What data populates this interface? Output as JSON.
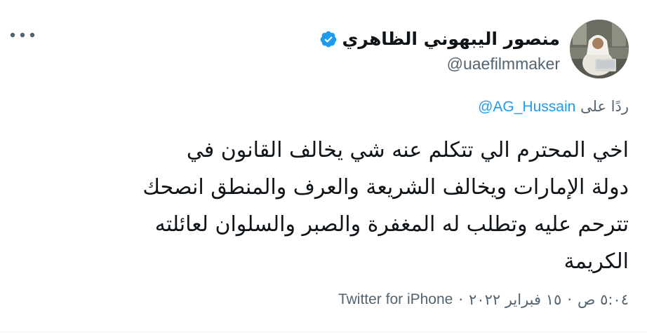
{
  "author": {
    "display_name": "منصور اليبهوني الظاهري",
    "handle": "@uaefilmmaker",
    "verified": true
  },
  "reply": {
    "prefix": "ردًا على",
    "target": "@AG_Hussain"
  },
  "body": [
    "اخي المحترم الي تتكلم عنه شي يخالف القانون في",
    "دولة الإمارات ويخالف الشريعة والعرف والمنطق انصحك",
    "تترحم عليه وتطلب له المغفرة والصبر والسلوان لعائلته",
    "الكريمة"
  ],
  "meta": {
    "time": "٥:٠٤ ص",
    "date": "١٥ فبراير ٢٠٢٢",
    "source": "Twitter for iPhone",
    "separator": "·"
  },
  "colors": {
    "text_primary": "#0f1419",
    "text_secondary": "#536471",
    "accent": "#1d9bf0",
    "divider": "#eff3f4"
  },
  "icons": {
    "verified": "verified-badge-icon",
    "more": "more-options-icon"
  }
}
